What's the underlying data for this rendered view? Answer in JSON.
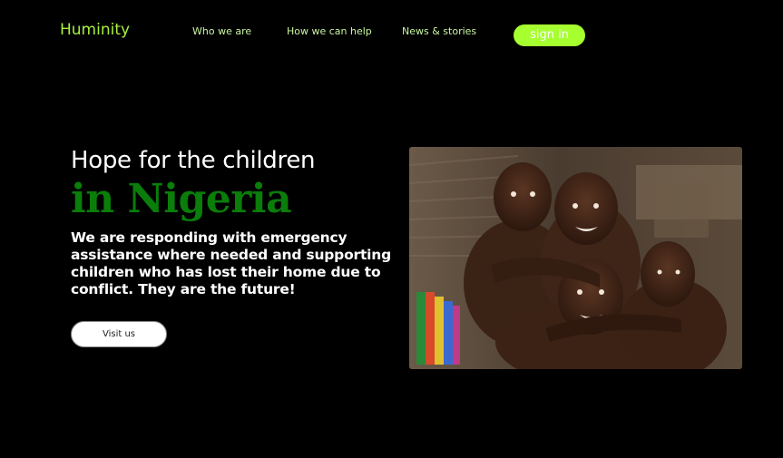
{
  "header": {
    "logo": "Huminity",
    "nav": [
      {
        "label": "Who we are"
      },
      {
        "label": "How we can help"
      },
      {
        "label": "News & stories"
      }
    ],
    "signin_label": "sign in"
  },
  "hero": {
    "title": "Hope for the children",
    "accent": "in Nigeria",
    "description": "We are responding with emergency assistance where needed and supporting children who has lost their home due to conflict. They are the future!",
    "button_label": "Visit us",
    "image": "photo of children smiling"
  },
  "colors": {
    "background": "#000000",
    "brand": "#a8f03c",
    "signin_bg": "#a6ff2e",
    "accent_text": "#0a7d0a"
  }
}
